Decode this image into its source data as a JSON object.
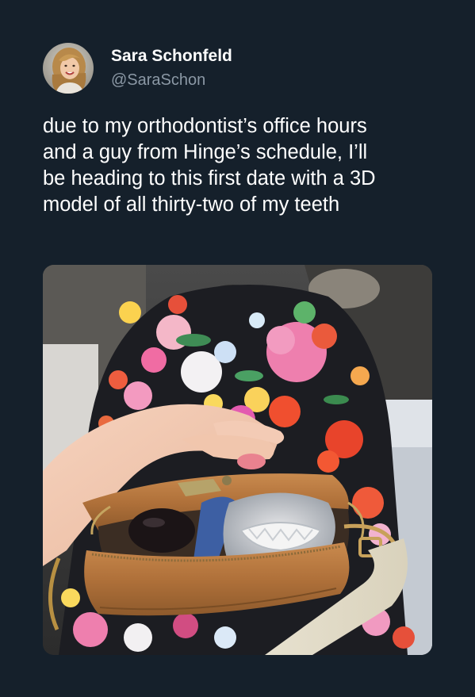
{
  "tweet": {
    "author": {
      "display_name": "Sara Schonfeld",
      "handle": "@SaraSchon",
      "avatar_icon": "profile-photo"
    },
    "text": "due to my orthodontist’s office hours\nand a guy from Hinge’s schedule, I’ll\nbe heading to this first date with a 3D\nmodel of all thirty-two of my teeth",
    "media": {
      "type": "photo",
      "subject": "hand holding open tan leather bag containing a 3D dental model, floral dress background"
    }
  },
  "colors": {
    "background": "#15202b",
    "text_primary": "#ffffff",
    "text_secondary": "#8b98a5"
  }
}
